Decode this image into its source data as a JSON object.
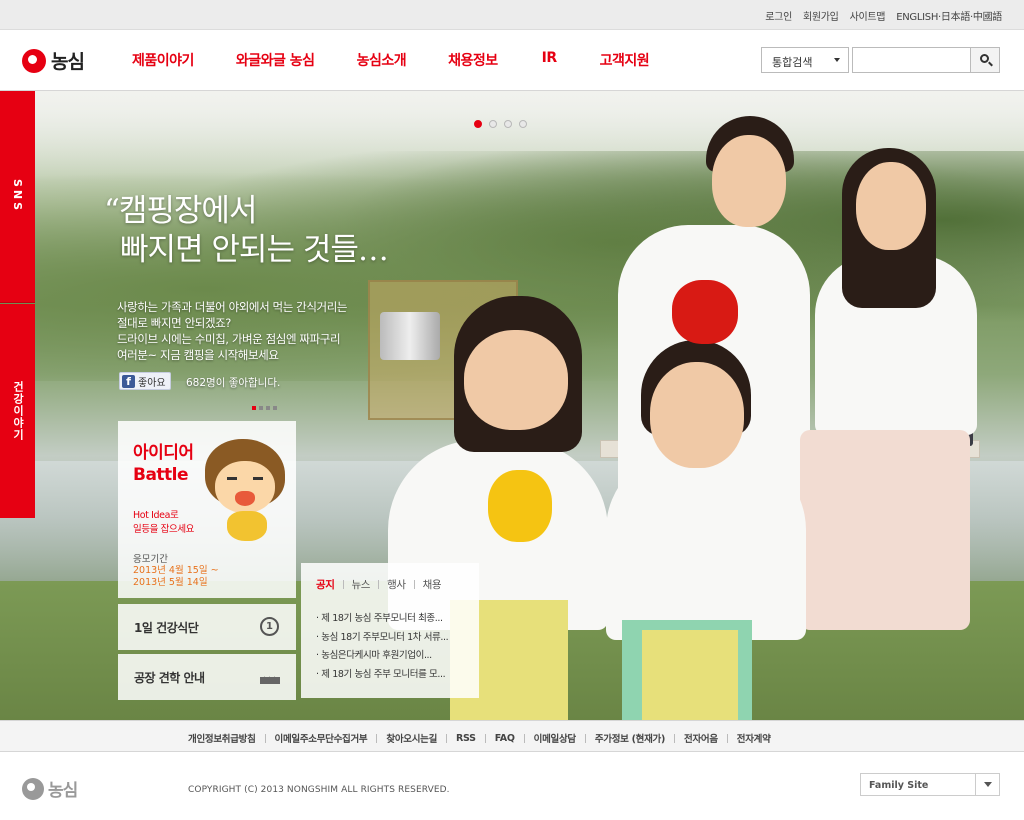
{
  "util_nav": [
    "로그인",
    "회원가입",
    "사이트맵",
    "ENGLISH·日本語·中國語"
  ],
  "brand": {
    "name": "농심",
    "accent": "#e60012"
  },
  "gnb": [
    "제품이야기",
    "와글와글 농심",
    "농심소개",
    "채용정보",
    "IR",
    "고객지원"
  ],
  "search": {
    "scope": "통합검색",
    "input_value": "",
    "button_icon": "search-icon"
  },
  "side_tabs": {
    "sns": "SNS",
    "health": "건강이야기"
  },
  "slider": {
    "count": 4,
    "active": 1
  },
  "hero": {
    "quote_mark": "“",
    "headline_line1": "캠핑장에서",
    "headline_line2": "빠지면 안되는 것들…",
    "desc": [
      "사랑하는 가족과 더불어 야외에서 먹는 간식거리는",
      "절대로 빠지면 안되겠죠?",
      "드라이브 시에는 수미칩, 가벼운 점심엔 짜파구리",
      "여러분~ 지금 캠핑을 시작해보세요"
    ],
    "like_label": "좋아요",
    "like_count": "682명이 좋아합니다."
  },
  "battle": {
    "title_line1": "아이디어",
    "title_line2": "Battle",
    "sub_line1": "Hot Idea로",
    "sub_line2": "일등을 잡으세요",
    "period_label": "응모기간",
    "period_line1": "2013년 4월 15일 ~",
    "period_line2": "2013년 5월 14일"
  },
  "boxes": {
    "health": "1일 건강식단",
    "health_num": "1",
    "factory": "공장 견학 안내"
  },
  "news": {
    "tabs": [
      "공지",
      "뉴스",
      "행사",
      "채용"
    ],
    "active_tab": 0,
    "items": [
      "· 제 18기 농심 주부모니터 최종...",
      "· 농심 18기 주부모니터 1차 서류...",
      "· 농심은다케시마 후원기업이...",
      "· 제 18기 농심 주부 모니터를 모..."
    ]
  },
  "footer_links": [
    "개인정보취급방침",
    "이메일주소무단수집거부",
    "찾아오시는길",
    "RSS",
    "FAQ",
    "이메일상담",
    "주가정보 (현재가)",
    "전자어음",
    "전자계약"
  ],
  "footer": {
    "logo": "농심",
    "copyright": "COPYRIGHT (C) 2013 NONGSHIM ALL RIGHTS RESERVED.",
    "family_site": "Family Site"
  }
}
